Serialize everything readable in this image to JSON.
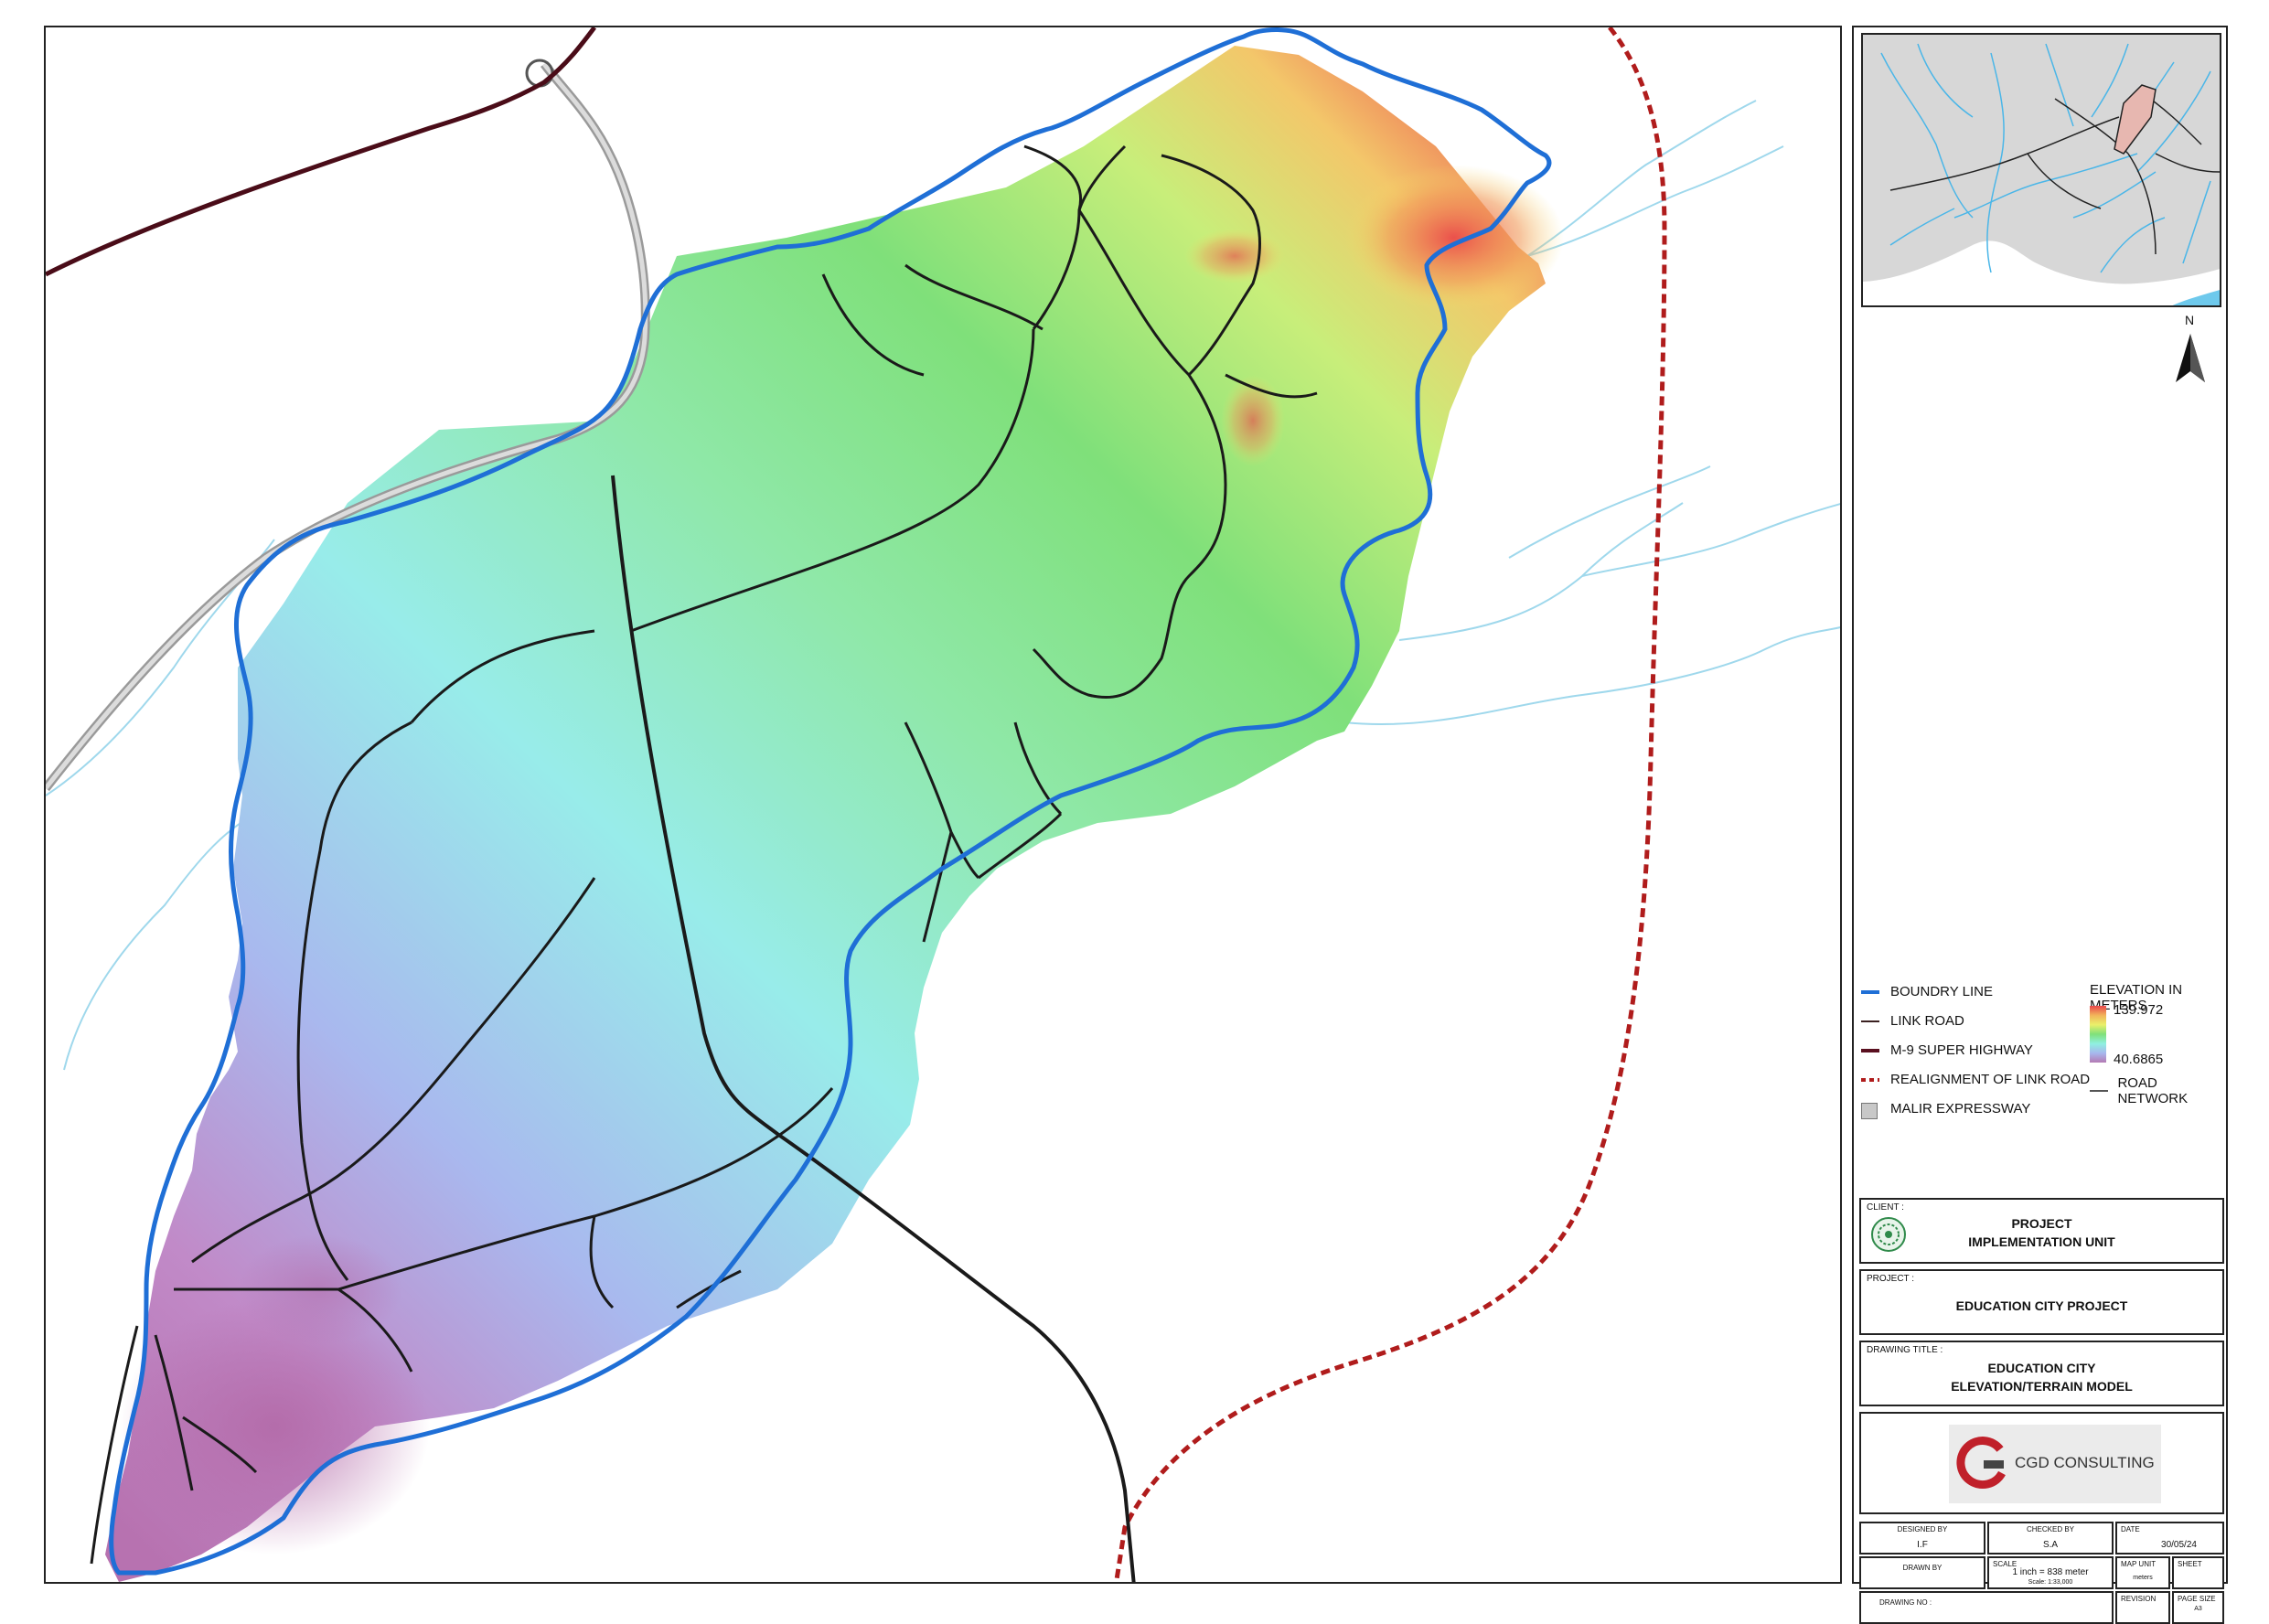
{
  "legend": {
    "items": [
      {
        "label": "BOUNDRY LINE",
        "color": "#1f6fd6"
      },
      {
        "label": "LINK ROAD",
        "color": "#3a2020"
      },
      {
        "label": "M-9 SUPER HIGHWAY",
        "color": "#5a1020"
      },
      {
        "label": "REALIGNMENT OF LINK ROAD",
        "color": "#b01c1c"
      },
      {
        "label": "MALIR EXPRESSWAY",
        "color": "#c8c8c8"
      }
    ],
    "elevation_title": "ELEVATION IN METERS",
    "elevation_max": "139.972",
    "elevation_min": "40.6865",
    "road_network": "ROAD NETWORK"
  },
  "north_label": "N",
  "title_block": {
    "client_label": "CLIENT :",
    "client_line1": "PROJECT",
    "client_line2": "IMPLEMENTATION UNIT",
    "project_label": "PROJECT :",
    "project_name": "EDUCATION CITY PROJECT",
    "drawing_title_label": "DRAWING TITLE :",
    "drawing_title_line1": "EDUCATION CITY",
    "drawing_title_line2": "ELEVATION/TERRAIN MODEL",
    "company_name": "CGD CONSULTING",
    "designed_by_label": "DESIGNED BY",
    "designed_by": "I.F",
    "checked_by_label": "CHECKED BY",
    "checked_by": "S.A",
    "date_label": "DATE",
    "date": "30/05/24",
    "drawn_by_label": "DRAWN BY",
    "scale_label": "SCALE",
    "scale_value": "1 inch = 838 meter",
    "scale_ratio": "Scale: 1:33,000",
    "map_unit_label": "MAP UNIT",
    "map_unit": "meters",
    "sheet_label": "SHEET",
    "drawing_no_label": "DRAWING NO :",
    "revision_label": "REVISION",
    "page_size_label": "PAGE SIZE",
    "page_size": "A3"
  }
}
